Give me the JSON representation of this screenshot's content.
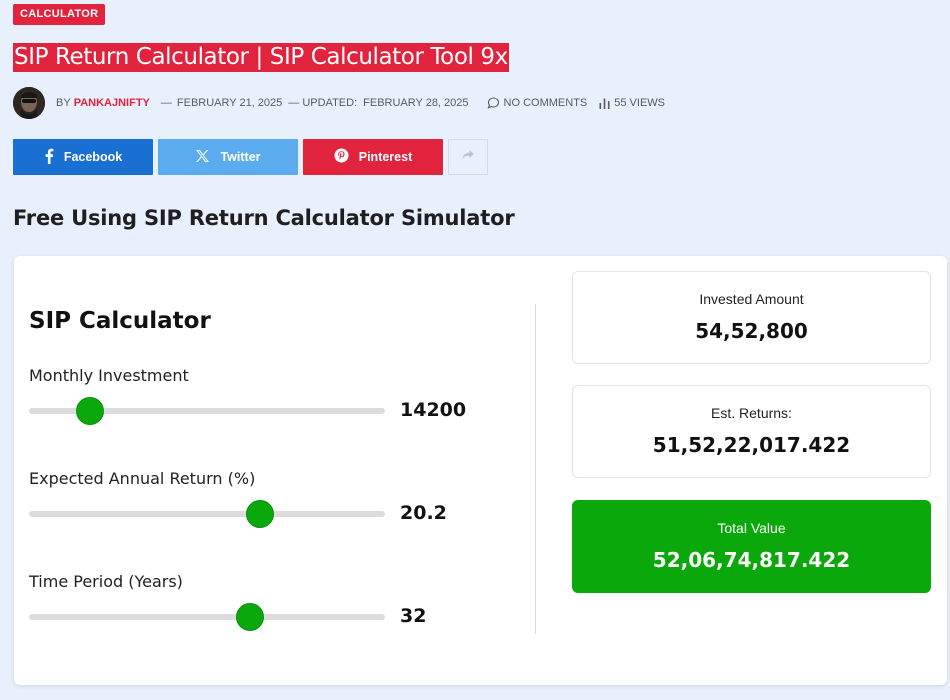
{
  "category_badge": "CALCULATOR",
  "title": "SIP Return Calculator | SIP Calculator Tool 9x",
  "meta": {
    "by": "BY",
    "author": "PANKAJNIFTY",
    "date_sep": "—",
    "published": "FEBRUARY 21, 2025",
    "updated_label": "— UPDATED:",
    "updated": "FEBRUARY 28, 2025",
    "comments": "NO COMMENTS",
    "views": "55 VIEWS"
  },
  "share": {
    "facebook": "Facebook",
    "twitter": "Twitter",
    "pinterest": "Pinterest",
    "more_icon": "share-arrow-icon"
  },
  "section_heading": "Free Using SIP Return Calculator Simulator",
  "calculator": {
    "title": "SIP Calculator",
    "fields": [
      {
        "label": "Monthly Investment",
        "value": "14200",
        "fill_fraction": 0.17
      },
      {
        "label": "Expected Annual Return (%)",
        "value": "20.2",
        "fill_fraction": 0.65
      },
      {
        "label": "Time Period (Years)",
        "value": "32",
        "fill_fraction": 0.62
      }
    ],
    "results": {
      "invested_label": "Invested Amount",
      "invested_value": "54,52,800",
      "returns_label": "Est. Returns:",
      "returns_value": "51,52,22,017.422",
      "total_label": "Total Value",
      "total_value": "52,06,74,817.422"
    }
  },
  "colors": {
    "accent_red": "#e2233e",
    "facebook_blue": "#1a6fd3",
    "twitter_blue": "#5aacee",
    "slider_green": "#0aa80a",
    "page_bg": "#e8f0fd"
  }
}
